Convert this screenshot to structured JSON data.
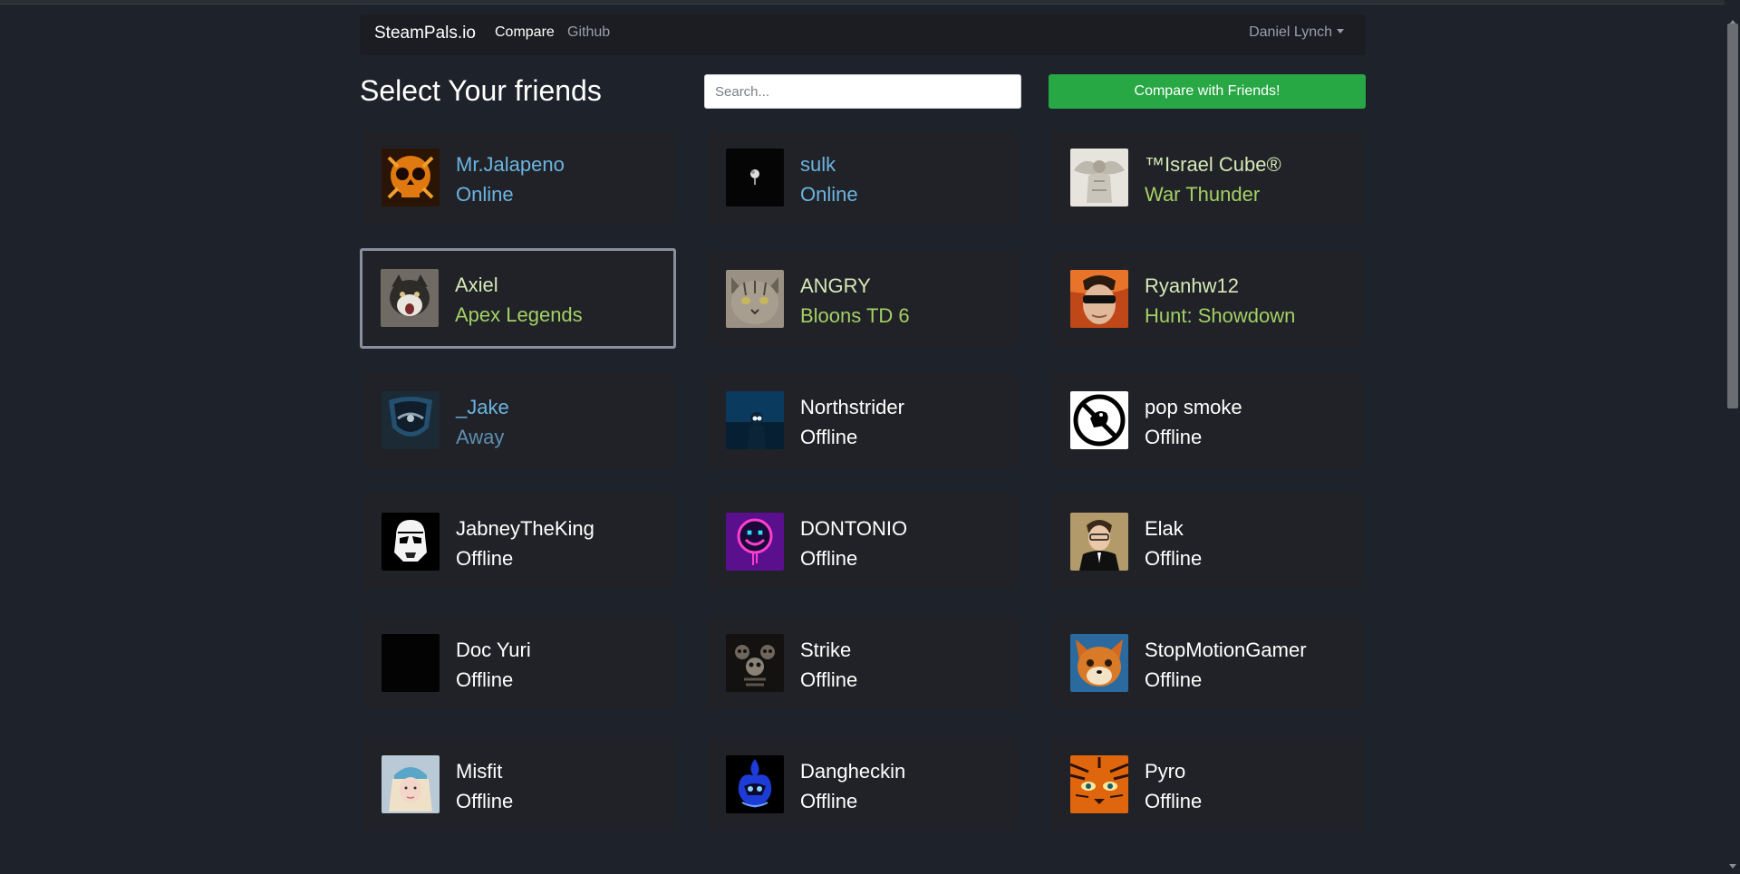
{
  "navbar": {
    "brand": "SteamPals.io",
    "links": [
      "Compare",
      "Github"
    ],
    "user": "Daniel Lynch"
  },
  "main": {
    "title": "Select Your friends",
    "search_placeholder": "Search...",
    "compare_button": "Compare with Friends!"
  },
  "friends": [
    {
      "name": "Mr.Jalapeno",
      "status": "Online",
      "state": "online",
      "avatar": "orange-skull-icon"
    },
    {
      "name": "sulk",
      "status": "Online",
      "state": "online",
      "avatar": "white-rose-icon"
    },
    {
      "name": "™Israel Cube®",
      "status": "War Thunder",
      "state": "in-game",
      "avatar": "angel-statue-icon"
    },
    {
      "name": "Axiel",
      "status": "Apex Legends",
      "state": "in-game",
      "avatar": "screaming-cat-icon",
      "selected": true
    },
    {
      "name": "ANGRY",
      "status": "Bloons TD 6",
      "state": "in-game",
      "avatar": "tabby-cat-icon"
    },
    {
      "name": "Ryanhw12",
      "status": "Hunt: Showdown",
      "state": "in-game",
      "avatar": "sunglasses-man-icon"
    },
    {
      "name": "_Jake",
      "status": "Away",
      "state": "away",
      "avatar": "shield-emblem-icon"
    },
    {
      "name": "Northstrider",
      "status": "Offline",
      "state": "offline",
      "avatar": "glowing-figure-icon"
    },
    {
      "name": "pop smoke",
      "status": "Offline",
      "state": "offline",
      "avatar": "no-bird-icon"
    },
    {
      "name": "JabneyTheKing",
      "status": "Offline",
      "state": "offline",
      "avatar": "stormtrooper-icon"
    },
    {
      "name": "DONTONIO",
      "status": "Offline",
      "state": "offline",
      "avatar": "neon-smiley-icon"
    },
    {
      "name": "Elak",
      "status": "Offline",
      "state": "offline",
      "avatar": "man-in-suit-icon"
    },
    {
      "name": "Doc Yuri",
      "status": "Offline",
      "state": "offline",
      "avatar": "black-square-icon"
    },
    {
      "name": "Strike",
      "status": "Offline",
      "state": "offline",
      "avatar": "skulls-icon"
    },
    {
      "name": "StopMotionGamer",
      "status": "Offline",
      "state": "offline",
      "avatar": "fox-icon"
    },
    {
      "name": "Misfit",
      "status": "Offline",
      "state": "offline",
      "avatar": "beanie-girl-icon"
    },
    {
      "name": "Dangheckin",
      "status": "Offline",
      "state": "offline",
      "avatar": "blue-flame-icon"
    },
    {
      "name": "Pyro",
      "status": "Offline",
      "state": "offline",
      "avatar": "tiger-face-icon"
    }
  ]
}
